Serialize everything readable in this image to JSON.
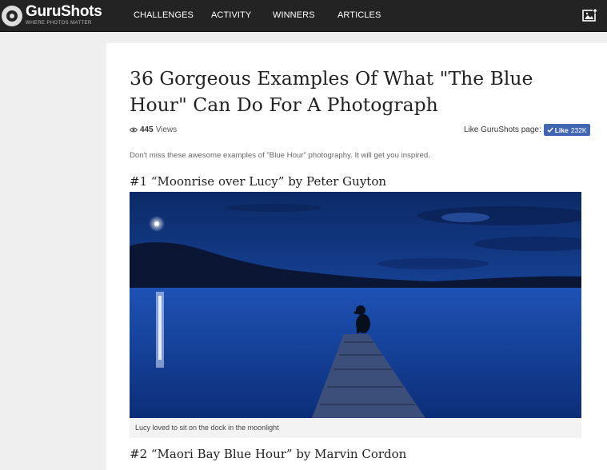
{
  "header": {
    "logo_name": "GuruShots",
    "logo_tagline": "WHERE PHOTOS MATTER",
    "nav": [
      {
        "label": "CHALLENGES"
      },
      {
        "label": "ACTIVITY"
      },
      {
        "label": "WINNERS"
      },
      {
        "label": "ARTICLES"
      }
    ],
    "upload_icon": "add-photo-icon"
  },
  "article": {
    "title": "36 Gorgeous Examples Of What \"The Blue Hour\" Can Do For A Photograph",
    "views_count": "445",
    "views_label": "Views",
    "like_page_label": "Like GuruShots page:",
    "fb_like_label": "Like",
    "fb_like_count": "232K",
    "intro": "Don't miss these awesome examples of \"Blue Hour\" photography. It will get you inspired.",
    "items": [
      {
        "heading": "#1 “Moonrise over Lucy” by Peter Guyton",
        "caption": "Lucy loved to sit on the dock in the moonlight"
      },
      {
        "heading": "#2 “Maori Bay Blue Hour” by Marvin Cordon"
      }
    ]
  },
  "colors": {
    "topbar": "#232323",
    "page_bg": "#efefef",
    "facebook_blue": "#4267b2"
  }
}
